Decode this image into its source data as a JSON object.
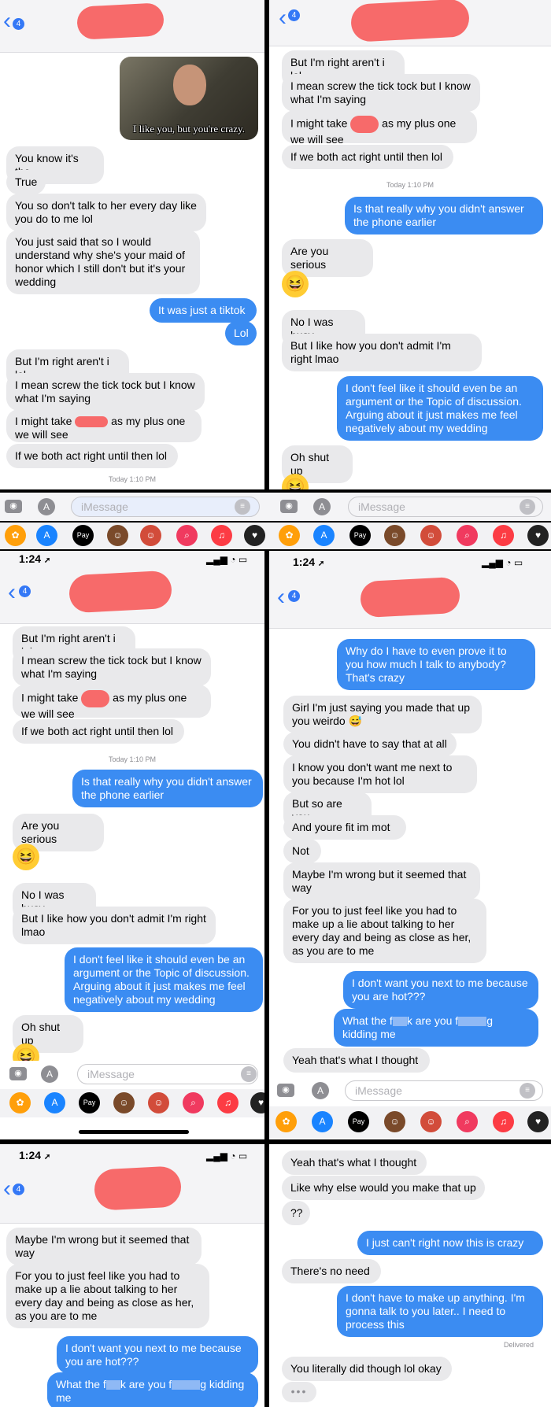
{
  "ui": {
    "back_arrow": "‹",
    "badge": "4",
    "input_placeholder": "iMessage",
    "time": "1:24",
    "location_arrow": "➚",
    "status_icons": "▂▄▆ ◔ ▭",
    "typing_dots": "•••",
    "apple_pay": "Pay",
    "icons": [
      "camera-icon",
      "app-store-icon",
      "mic-icon",
      "photos-icon",
      "apple-pay-icon",
      "memoji-icon",
      "image-search-icon",
      "music-icon",
      "heart-icon"
    ],
    "colors": {
      "incoming": "#e9e9eb",
      "outgoing": "#3b8cf2",
      "redaction": "#f76a6a",
      "accent": "#3478f6"
    }
  },
  "p1": {
    "meme_caption": "I like you, but you're crazy.",
    "m": [
      "You know it's the",
      "True",
      "You so don't talk to her every day like you do to me lol",
      "You just said that so I would understand why she's your maid of honor which I still don't but it's your wedding",
      "It was just a tiktok",
      "Lol",
      "But I'm right aren't i lol",
      "I mean screw the tick tock but I know what I'm saying",
      "I might take",
      "as my plus one we will see",
      "If we both act right until then lol"
    ],
    "ts": "Today 1:10 PM"
  },
  "p2": {
    "m": [
      "But I'm right aren't i lol",
      "I mean screw the tick tock but I know what I'm saying",
      "I might take",
      "as my plus one we will see",
      "If we both act right until then lol",
      "Is that really why you didn't answer the phone earlier",
      "Are you serious",
      "😆",
      "No I was busy",
      "But I like how you don't admit I'm right lmao",
      "I don't feel like it should even be an argument or the Topic of discussion. Arguing about it just makes me feel negatively about my wedding",
      "Oh shut up"
    ],
    "ts": "Today 1:10 PM"
  },
  "p3": {
    "m": [
      "But I'm right aren't i lol",
      "I mean screw the tick tock but I know what I'm saying",
      "I might take",
      "as my plus one we will see",
      "If we both act right until then lol",
      "Is that really why you didn't answer the phone earlier",
      "Are you serious",
      "😆",
      "No I was busy",
      "But I like how you don't admit I'm right lmao",
      "I don't feel like it should even be an argument or the Topic of discussion. Arguing about it just makes me feel negatively about my wedding",
      "Oh shut up"
    ],
    "ts": "Today 1:10 PM"
  },
  "p4": {
    "m": [
      "Why do I have to even prove it to you how much I talk to anybody? That's crazy",
      "Girl I'm just saying you made that up you weirdo 😅",
      "You didn't have to say that at all",
      "I know you don't want me next to you because I'm hot lol",
      "But so are you.",
      "And youre fit im mot",
      "Not",
      "Maybe I'm wrong but it seemed that way",
      "For you to just feel like you had to make up a lie about talking to her every day and being as close as her, as you are to me",
      "I don't want you next to me because you are hot???",
      "What the f",
      "k are you f",
      "g kidding me",
      "Yeah that's what I thought"
    ]
  },
  "p5": {
    "m": [
      "Maybe I'm wrong but it seemed that way",
      "For you to just feel like you had to make up a lie about talking to her every day and being as close as her, as you are to me",
      "I don't want you next to me because you are hot???",
      "What the f",
      "k are you f",
      "g kidding me"
    ]
  },
  "p6": {
    "m": [
      "Yeah that's what I thought",
      "Like why else would you make that up",
      "??",
      "I just can't right now this is crazy",
      "There's no need",
      "I don't have to make up anything. I'm gonna talk to you later.. I need to process this",
      "You literally did though lol okay"
    ],
    "delivered": "Delivered"
  }
}
